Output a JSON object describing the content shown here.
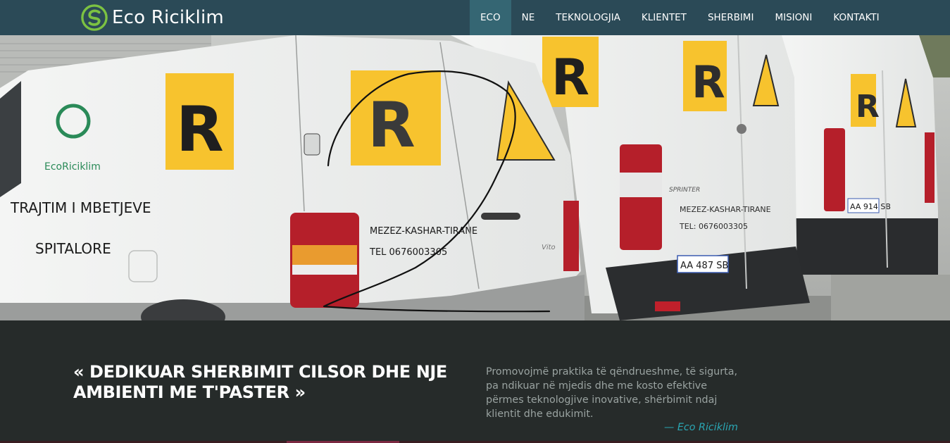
{
  "brand": {
    "name": "Eco Riciklim"
  },
  "nav": [
    {
      "label": "ECO",
      "active": true
    },
    {
      "label": "NE"
    },
    {
      "label": "TEKNOLOGJIA"
    },
    {
      "label": "KLIENTET"
    },
    {
      "label": "SHERBIMI"
    },
    {
      "label": "MISIONI"
    },
    {
      "label": "KONTAKTI"
    }
  ],
  "hero": {
    "van1": {
      "logo_text": "EcoRiciklim",
      "side_line1": "TRAJTIM I MBETJEVE",
      "side_line2": "SPITALORE",
      "sign": "R",
      "address": "MEZEZ-KASHAR-TIRANE",
      "phone": "TEL 0676003305",
      "model": "Vito"
    },
    "van2": {
      "sign": "R",
      "address": "MEZEZ-KASHAR-TIRANE",
      "phone": "TEL: 0676003305",
      "plate": "AA 487 SB",
      "model": "SPRINTER"
    },
    "van3": {
      "sign": "R",
      "plate": "AA 914 SB"
    }
  },
  "quote": {
    "slogan": "« DEDIKUAR SHERBIMIT CILSOR DHE NJE AMBIENTI ME T'PASTER »",
    "text": "Promovojmë praktika të qëndrueshme, të sigurta, pa ndikuar në mjedis dhe me kosto efektive përmes teknologjive inovative, shërbimit ndaj klientit dhe edukimit.",
    "author": "— Eco Riciklim"
  },
  "colors": {
    "nav_bg": "#2b4a57",
    "nav_active": "#356673",
    "band_bg": "#262b2a",
    "accent": "#2aa6b3",
    "sign_yellow": "#f7c32e"
  }
}
